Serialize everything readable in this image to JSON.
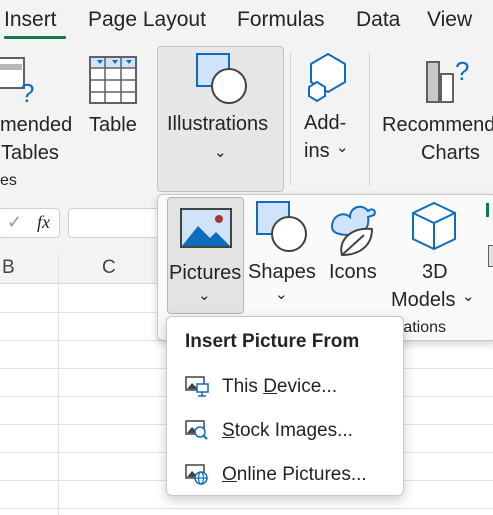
{
  "tabs": [
    {
      "label": "Insert",
      "active": true
    },
    {
      "label": "Page Layout"
    },
    {
      "label": "Formulas"
    },
    {
      "label": "Data"
    },
    {
      "label": "View"
    }
  ],
  "ribbon": {
    "recommended_tables": {
      "line1": "mended",
      "line2": "Tables"
    },
    "table": {
      "label": "Table"
    },
    "group_label": "es",
    "illustrations": {
      "label": "Illustrations"
    },
    "addins": {
      "line1": "Add-",
      "line2": "ins"
    },
    "recommended_charts": {
      "line1": "Recommend",
      "line2": "Charts"
    }
  },
  "formula_bar": {
    "fx": "fx",
    "check": "✓"
  },
  "columns": [
    "B",
    "C"
  ],
  "gallery": {
    "pictures": "Pictures",
    "shapes": "Shapes",
    "icons": "Icons",
    "models_line1": "3D",
    "models_line2": "Models",
    "group_label": "rations"
  },
  "picture_menu": {
    "title": "Insert Picture From",
    "items": [
      {
        "pre": "This ",
        "ul": "D",
        "post": "evice...",
        "icon": "device-picture-icon"
      },
      {
        "pre": "",
        "ul": "S",
        "post": "tock Images...",
        "icon": "stock-images-icon"
      },
      {
        "pre": "",
        "ul": "O",
        "post": "nline Pictures...",
        "icon": "online-pictures-icon"
      }
    ]
  },
  "colors": {
    "accent": "#107c41",
    "icon_blue": "#0f6cbd",
    "icon_fill": "#cfe4fa"
  }
}
